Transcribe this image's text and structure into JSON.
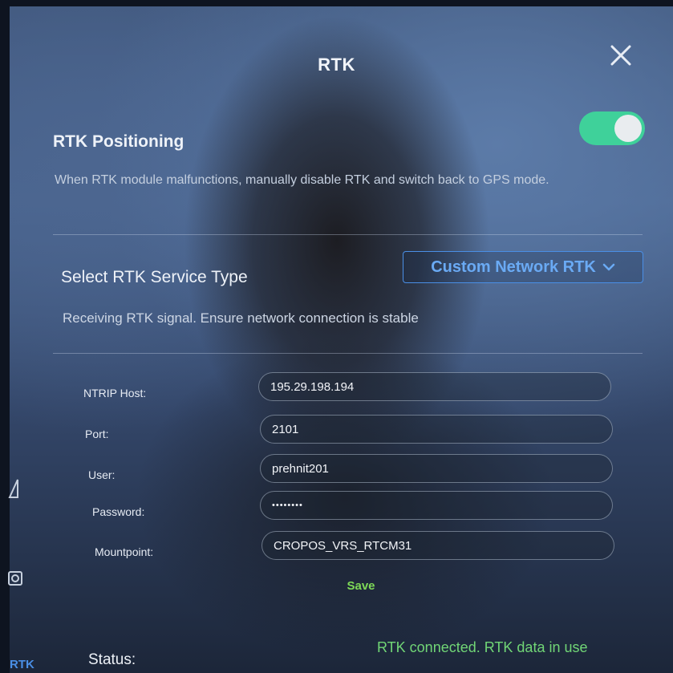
{
  "dialog": {
    "title": "RTK"
  },
  "rtk_positioning": {
    "label": "RTK Positioning",
    "enabled": true,
    "description": "When RTK module malfunctions, manually disable RTK and switch back to GPS mode."
  },
  "service_type": {
    "label": "Select RTK Service Type",
    "selected": "Custom Network RTK",
    "hint": "Receiving RTK signal. Ensure network connection is stable"
  },
  "fields": {
    "ntrip_host": {
      "label": "NTRIP Host:",
      "value": "195.29.198.194"
    },
    "port": {
      "label": "Port:",
      "value": "2101"
    },
    "user": {
      "label": "User:",
      "value": "prehnit201"
    },
    "password": {
      "label": "Password:",
      "value": "••••••••"
    },
    "mountpoint": {
      "label": "Mountpoint:",
      "value": "CROPOS_VRS_RTCM31"
    }
  },
  "save_label": "Save",
  "status": {
    "label": "Status:",
    "value": "RTK connected. RTK data in use"
  },
  "sidebar": {
    "rtk_label": "RTK"
  },
  "colors": {
    "accent_blue": "#4a8fe6",
    "toggle_on": "#3fd19a",
    "status_green": "#71d676",
    "save_green": "#7ed957"
  },
  "icons": {
    "close": "close-icon",
    "dropdown": "chevron-down-icon",
    "camera": "camera-icon",
    "navigation": "navigation-icon"
  }
}
